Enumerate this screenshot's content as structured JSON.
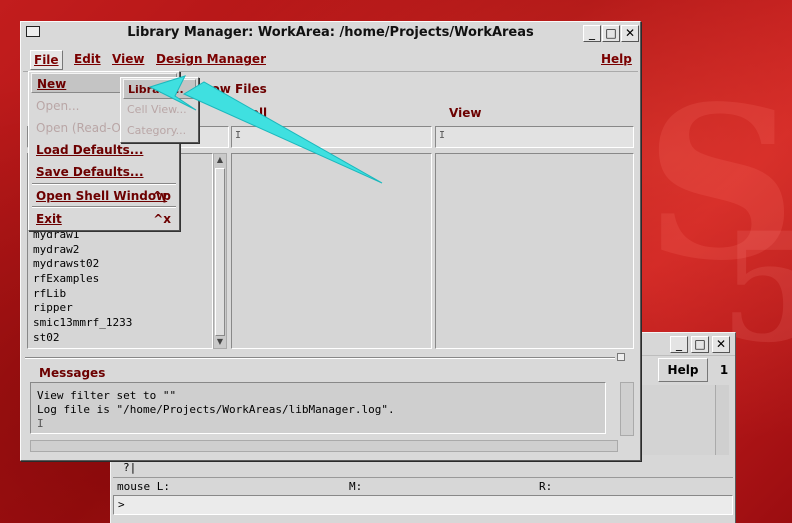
{
  "colors": {
    "desktop_red": "#b9181a",
    "window_gray": "#d9d9d9",
    "label_maroon": "#6c0000",
    "annotation_cyan": "#3fe0e0"
  },
  "ciw": {
    "help_label": "Help",
    "tab_number": "1",
    "prompt_text": "?|",
    "mouse_left": "mouse L:",
    "mouse_middle": "M:",
    "mouse_right": "R:",
    "command_prompt": ">"
  },
  "library_manager": {
    "title": "Library Manager: WorkArea: /home/Projects/WorkAreas",
    "window_buttons": {
      "minimize": "_",
      "maximize": "□",
      "close": "✕"
    },
    "menu": {
      "file": "File",
      "edit": "Edit",
      "view": "View",
      "design_manager": "Design Manager",
      "help": "Help"
    },
    "show_files_label": "how Files",
    "cell_header": "Cell",
    "view_header": "View",
    "filter_cursor": "I",
    "libraries": [
      "mydraw1",
      "mydraw2",
      "mydrawst02",
      "rfExamples",
      "rfLib",
      "ripper",
      "smic13mmrf_1233",
      "st02"
    ],
    "messages_label": "Messages",
    "messages": [
      "View filter set to \"\"",
      "Log file is \"/home/Projects/WorkAreas/libManager.log\"."
    ],
    "messages_cursor": "I"
  },
  "file_menu": {
    "new": "New",
    "open": "Open...",
    "open_read_only": "Open (Read-Or",
    "load_defaults": "Load Defaults...",
    "save_defaults": "Save Defaults...",
    "open_shell": "Open Shell Window",
    "open_shell_accel": "^p",
    "exit": "Exit",
    "exit_accel": "^x"
  },
  "new_submenu": {
    "library": "Library...",
    "cell_view": "Cell View...",
    "category": "Category..."
  }
}
